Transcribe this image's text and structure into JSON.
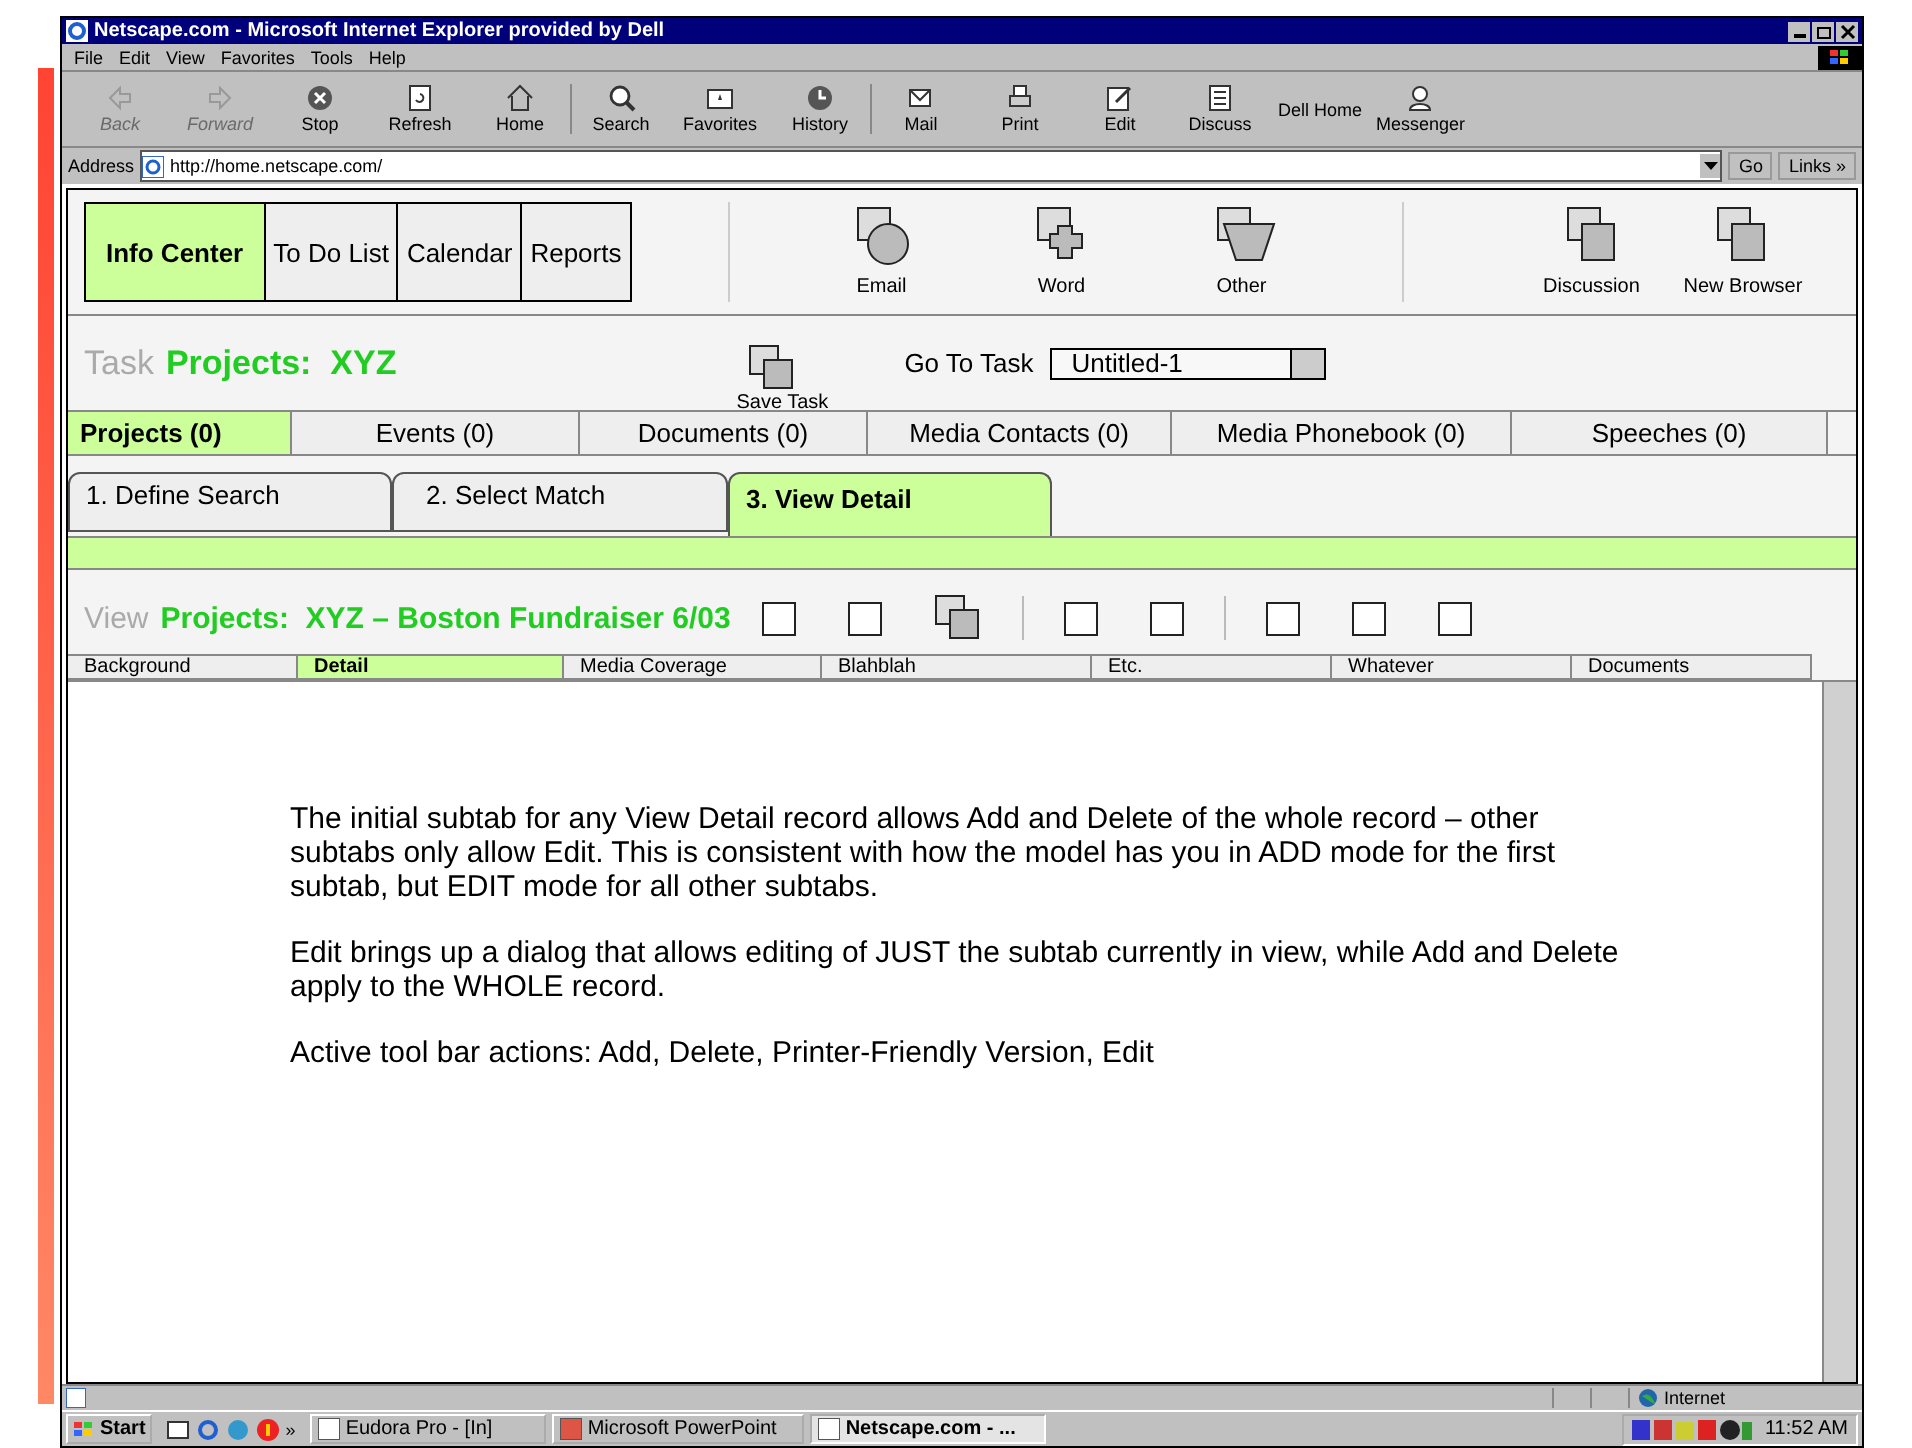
{
  "window": {
    "title": "Netscape.com - Microsoft Internet Explorer provided by Dell"
  },
  "menu": [
    "File",
    "Edit",
    "View",
    "Favorites",
    "Tools",
    "Help"
  ],
  "toolbar": [
    {
      "label": "Back",
      "kind": "back",
      "disabled": true
    },
    {
      "label": "Forward",
      "kind": "forward",
      "disabled": true
    },
    {
      "label": "Stop",
      "kind": "stop",
      "disabled": false
    },
    {
      "label": "Refresh",
      "kind": "refresh",
      "disabled": false
    },
    {
      "label": "Home",
      "kind": "home",
      "disabled": false
    },
    {
      "label": "Search",
      "kind": "search",
      "disabled": false
    },
    {
      "label": "Favorites",
      "kind": "favorites",
      "disabled": false
    },
    {
      "label": "History",
      "kind": "history",
      "disabled": false
    },
    {
      "label": "Mail",
      "kind": "mail",
      "disabled": false
    },
    {
      "label": "Print",
      "kind": "print",
      "disabled": false
    },
    {
      "label": "Edit",
      "kind": "edit",
      "disabled": false
    },
    {
      "label": "Discuss",
      "kind": "discuss",
      "disabled": false
    },
    {
      "label": "Dell Home",
      "kind": "text",
      "disabled": false
    },
    {
      "label": "Messenger",
      "kind": "messenger",
      "disabled": false
    }
  ],
  "address": {
    "label": "Address",
    "url": "http://home.netscape.com/",
    "go": "Go",
    "links": "Links »"
  },
  "nav_tabs": [
    {
      "label": "Info Center",
      "selected": true
    },
    {
      "label": "To Do List",
      "selected": false
    },
    {
      "label": "Calendar",
      "selected": false
    },
    {
      "label": "Reports",
      "selected": false
    }
  ],
  "tool_groups": [
    [
      {
        "label": "Email",
        "kind": "circle"
      },
      {
        "label": "Word",
        "kind": "cross"
      },
      {
        "label": "Other",
        "kind": "trapezoid"
      }
    ],
    [
      {
        "label": "Discussion",
        "kind": "square"
      },
      {
        "label": "New Browser",
        "kind": "square"
      }
    ]
  ],
  "task": {
    "label": "Task",
    "title": "Projects:  XYZ",
    "save": "Save Task",
    "goto_label": "Go To Task",
    "goto_value": "Untitled-1"
  },
  "category_tabs": [
    {
      "label": "Projects (0)",
      "selected": true
    },
    {
      "label": "Events (0)",
      "selected": false
    },
    {
      "label": "Documents (0)",
      "selected": false
    },
    {
      "label": "Media Contacts (0)",
      "selected": false
    },
    {
      "label": "Media Phonebook (0)",
      "selected": false
    },
    {
      "label": "Speeches (0)",
      "selected": false
    }
  ],
  "steps": [
    {
      "label": "1.  Define Search",
      "selected": false
    },
    {
      "label": "2. Select Match",
      "selected": false
    },
    {
      "label": "3. View Detail",
      "selected": true
    }
  ],
  "view": {
    "label": "View",
    "title": "Projects:  XYZ – Boston Fundraiser 6/03",
    "tool_groups": [
      [
        {
          "kind": "box"
        },
        {
          "kind": "box"
        },
        {
          "kind": "stack"
        }
      ],
      [
        {
          "kind": "box"
        },
        {
          "kind": "box"
        }
      ],
      [
        {
          "kind": "box"
        },
        {
          "kind": "box"
        },
        {
          "kind": "box"
        }
      ]
    ]
  },
  "subtabs": [
    {
      "label": "Background",
      "selected": false
    },
    {
      "label": "Detail",
      "selected": true
    },
    {
      "label": "Media Coverage",
      "selected": false
    },
    {
      "label": "Blahblah",
      "selected": false
    },
    {
      "label": "Etc.",
      "selected": false
    },
    {
      "label": "Whatever",
      "selected": false
    },
    {
      "label": "Documents",
      "selected": false
    }
  ],
  "paragraphs": [
    "The initial subtab for any View Detail record allows Add and Delete of the whole record – other subtabs only allow Edit.  This is consistent with how the model has you in ADD mode for the first subtab, but EDIT mode for all other subtabs.",
    "Edit brings up a dialog that allows editing of JUST the subtab currently in view, while Add and Delete apply to the WHOLE record.",
    "Active tool bar actions:  Add, Delete, Printer-Friendly Version, Edit"
  ],
  "status_bar": {
    "zone": "Internet"
  },
  "taskbar": {
    "start": "Start",
    "more": "»",
    "tasks": [
      {
        "label": "Eudora Pro - [In]",
        "selected": false
      },
      {
        "label": "Microsoft PowerPoint",
        "selected": false
      },
      {
        "label": "Netscape.com - ...",
        "selected": true
      }
    ],
    "time": "11:52 AM"
  }
}
